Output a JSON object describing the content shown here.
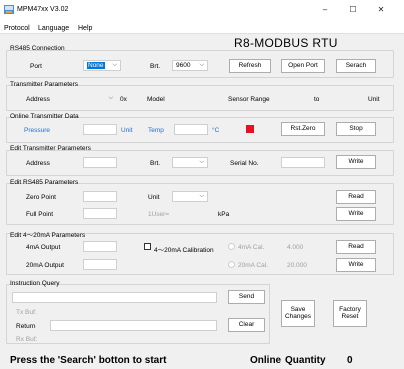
{
  "window": {
    "title": "MPM47xx V3.02",
    "minimize": "–",
    "maximize": "☐",
    "close": "✕"
  },
  "menu": [
    "Protocol",
    "Language",
    "Help"
  ],
  "header": {
    "title": "R8-MODBUS RTU"
  },
  "rs485": {
    "title": "RS485 Connection",
    "port_label": "Port",
    "port_value": "None",
    "brt_label": "Brt.",
    "brt_value": "9600",
    "refresh": "Refresh",
    "open_port": "Open Port",
    "search": "Serach"
  },
  "transmitter": {
    "title": "Transmitter Parameters",
    "address_label": "Address",
    "hex_prefix": "0x",
    "model_label": "Model",
    "sensor_range_label": "Sensor Range",
    "to_label": "to",
    "unit_label": "Unit"
  },
  "online": {
    "title": "Online Transmitter Data",
    "pressure_label": "Pressure",
    "unit_label": "Unit",
    "temp_label": "Temp",
    "temp_unit": "°C",
    "rst_zero": "Rst.Zero",
    "stop": "Stop",
    "indicator_color": "#e81123"
  },
  "edit_transmitter": {
    "title": "Edit Transmitter Parameters",
    "address_label": "Address",
    "brt_label": "Brt.",
    "serial_label": "Serial No.",
    "write": "Write"
  },
  "edit_rs485": {
    "title": "Edit RS485 Parameters",
    "zero_label": "Zero Point",
    "unit_label": "Unit",
    "full_label": "Full Point",
    "user_label": "1User=",
    "kpa_label": "kPa",
    "read": "Read",
    "write": "Write"
  },
  "edit_ma": {
    "title": "Edit 4～20mA Parameters",
    "out4_label": "4mA Output",
    "calib_label": "4～20mA Calibration",
    "cal4_label": "4mA Cal.",
    "cal4_value": "4.000",
    "out20_label": "20mA Output",
    "cal20_label": "20mA Cal.",
    "cal20_value": "20.000",
    "read": "Read",
    "write": "Write"
  },
  "instruction": {
    "title": "Instruction Query",
    "send": "Send",
    "tx_label": "Tx Buf:",
    "return_label": "Return",
    "clear": "Clear",
    "rx_label": "Rx Buf:"
  },
  "actions": {
    "save_changes": "Save Changes",
    "factory_reset": "Factory Reset"
  },
  "status": {
    "message": "Press the 'Search' botton to start",
    "online_label": "Online",
    "quantity_label": "Quantity",
    "quantity_value": "0"
  }
}
